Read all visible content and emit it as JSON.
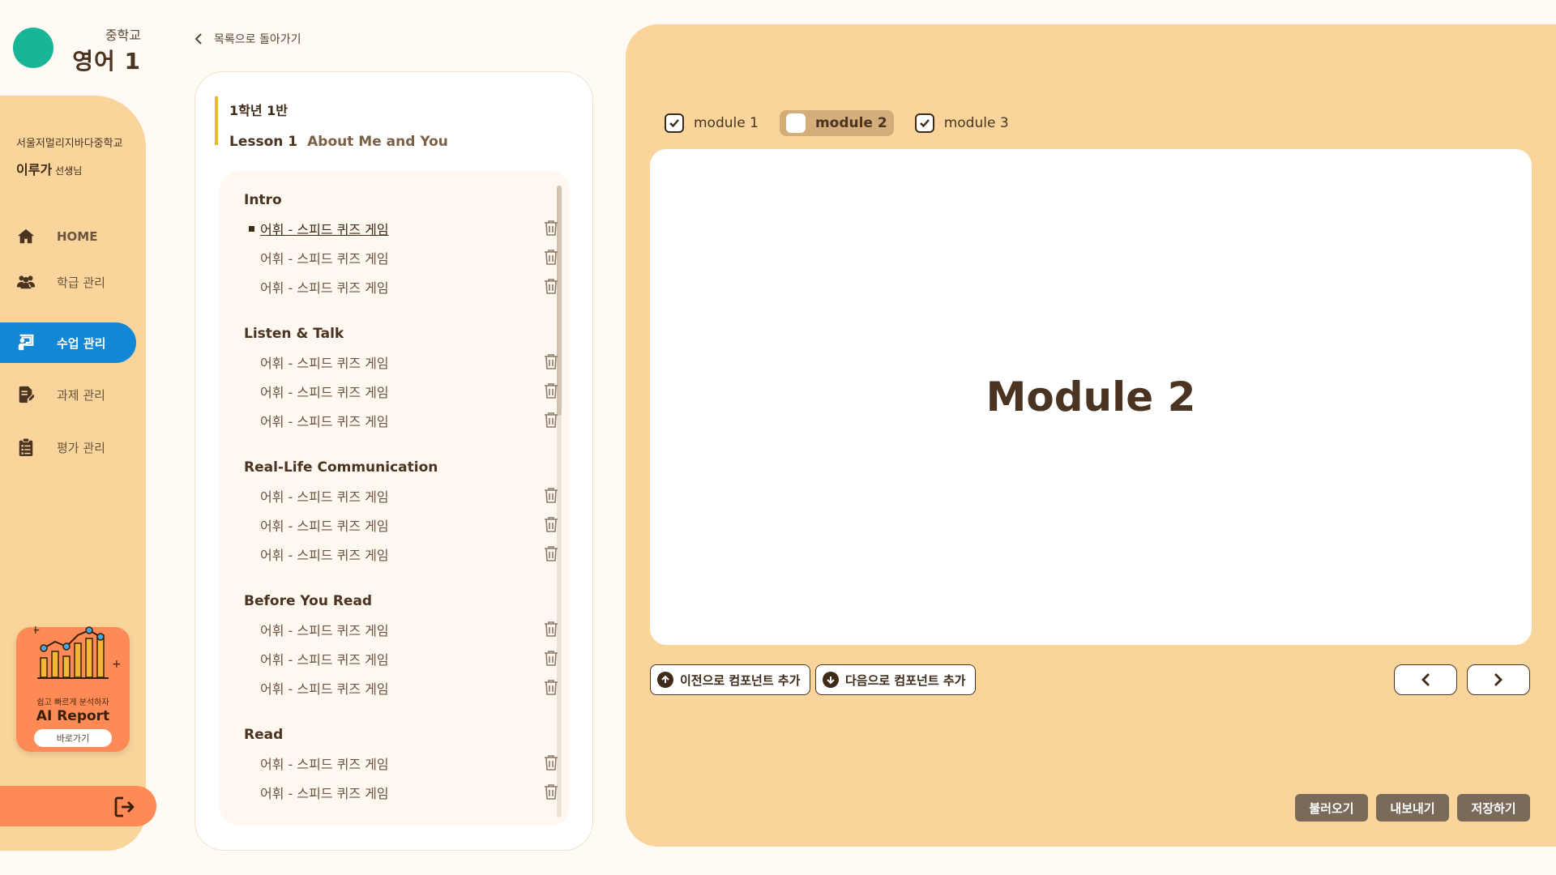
{
  "brand": {
    "school_level": "중학교",
    "subject": "영어 1"
  },
  "sidebar": {
    "school_name": "서울저멀리지바다중학교",
    "teacher_name": "이루가",
    "teacher_suffix": "선생님",
    "items": [
      {
        "label": "HOME",
        "icon": "home-icon"
      },
      {
        "label": "학급 관리",
        "icon": "users-icon"
      },
      {
        "label": "수업 관리",
        "icon": "chalkboard-teacher-icon"
      },
      {
        "label": "과제 관리",
        "icon": "edit-document-icon"
      },
      {
        "label": "평가 관리",
        "icon": "clipboard-list-icon"
      }
    ],
    "active_index": 2,
    "ai_card": {
      "tagline": "쉽고 빠르게 분석하자",
      "title": "AI Report",
      "button": "바로가기"
    }
  },
  "lesson": {
    "back_label": "목록으로 돌아가기",
    "class_name": "1학년 1반",
    "lesson_no": "Lesson 1",
    "lesson_title": "About Me and You",
    "sections": [
      {
        "title": "Intro",
        "items": [
          "어휘 - 스피드 퀴즈 게임",
          "어휘 - 스피드 퀴즈 게임",
          "어휘 - 스피드 퀴즈 게임"
        ]
      },
      {
        "title": "Listen & Talk",
        "items": [
          "어휘 - 스피드 퀴즈 게임",
          "어휘 - 스피드 퀴즈 게임",
          "어휘 - 스피드 퀴즈 게임"
        ]
      },
      {
        "title": "Real-Life Communication",
        "items": [
          "어휘 - 스피드 퀴즈 게임",
          "어휘 - 스피드 퀴즈 게임",
          "어휘 - 스피드 퀴즈 게임"
        ]
      },
      {
        "title": "Before You Read",
        "items": [
          "어휘 - 스피드 퀴즈 게임",
          "어휘 - 스피드 퀴즈 게임",
          "어휘 - 스피드 퀴즈 게임"
        ]
      },
      {
        "title": "Read",
        "items": [
          "어휘 - 스피드 퀴즈 게임",
          "어휘 - 스피드 퀴즈 게임"
        ]
      }
    ]
  },
  "modules": {
    "tabs": [
      {
        "label": "module 1",
        "checked": true
      },
      {
        "label": "module 2",
        "checked": false
      },
      {
        "label": "module 3",
        "checked": true
      }
    ],
    "active_index": 1,
    "canvas_title": "Module 2",
    "add_prev_label": "이전으로 컴포넌트 추가",
    "add_next_label": "다음으로 컴포넌트 추가",
    "actions": {
      "load": "불러오기",
      "export": "내보내기",
      "save": "저장하기"
    }
  },
  "colors": {
    "accent_blue": "#1187d6",
    "sidebar_bg": "#f9d59c",
    "ai_card": "#fe8a55",
    "logo_green": "#18b596",
    "text_brown": "#4a3421",
    "action_button": "#7a6a5a"
  }
}
